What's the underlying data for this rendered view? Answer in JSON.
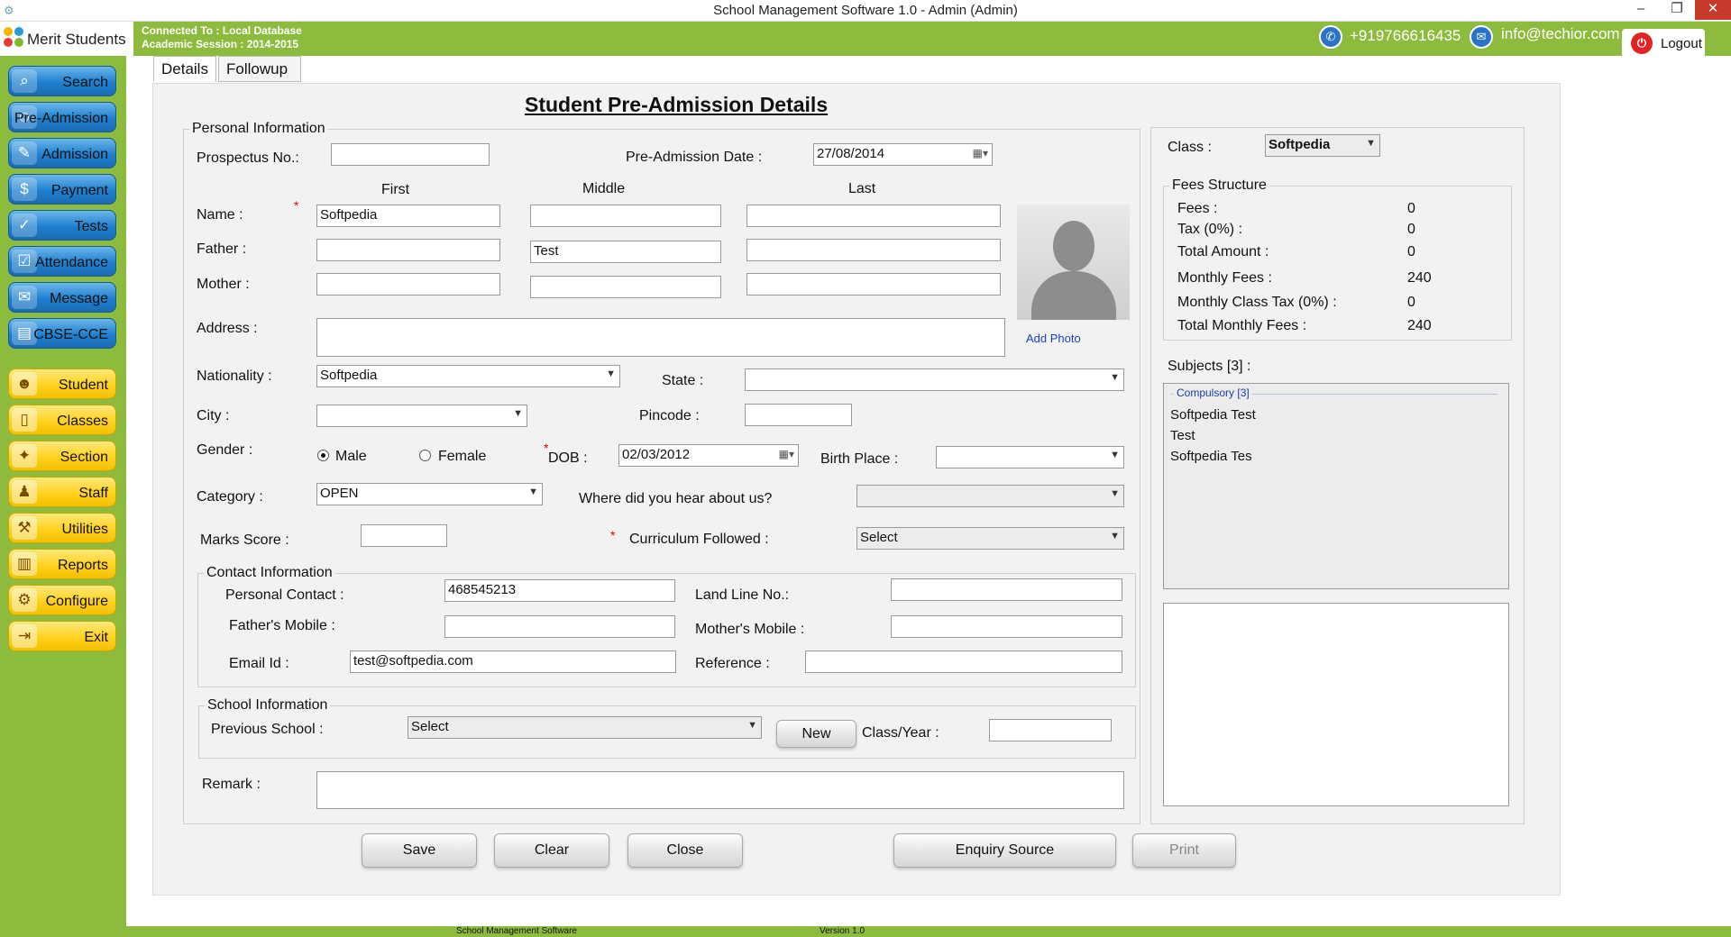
{
  "window": {
    "title": "School Management Software 1.0  -  Admin (Admin)",
    "min": "–",
    "max": "❐",
    "close": "✕"
  },
  "brand": {
    "name": "Merit Students"
  },
  "connection": {
    "line1": "Connected To : Local Database",
    "line2": "Academic Session : 2014-2015"
  },
  "contact": {
    "phone": "+919766616435",
    "email": "info@techior.com"
  },
  "logout": {
    "label": "Logout"
  },
  "sidebar": {
    "blue": [
      "Search",
      "Pre-Admission",
      "Admission",
      "Payment",
      "Tests",
      "Attendance",
      "Message",
      "CBSE-CCE"
    ],
    "yellow": [
      "Student",
      "Classes",
      "Section",
      "Staff",
      "Utilities",
      "Reports",
      "Configure",
      "Exit"
    ]
  },
  "tabs": [
    "Details",
    "Followup"
  ],
  "page": {
    "title": "Student Pre-Admission Details"
  },
  "personal": {
    "legend": "Personal Information",
    "prospectus_label": "Prospectus No.:",
    "prospectus_value": "",
    "preadmission_date_label": "Pre-Admission Date :",
    "preadmission_date": "27/08/2014",
    "col_first": "First",
    "col_middle": "Middle",
    "col_last": "Last",
    "name_label": "Name :",
    "name_first": "Softpedia",
    "name_middle": "",
    "name_last": "",
    "father_label": "Father :",
    "father_first": "",
    "father_middle": "Test",
    "father_last": "",
    "mother_label": "Mother :",
    "mother_first": "",
    "mother_middle": "",
    "mother_last": "",
    "address_label": "Address :",
    "address_value": "",
    "add_photo": "Add Photo",
    "nationality_label": "Nationality :",
    "nationality_value": "Softpedia",
    "state_label": "State :",
    "state_value": "",
    "city_label": "City :",
    "city_value": "",
    "pincode_label": "Pincode :",
    "pincode_value": "",
    "gender_label": "Gender :",
    "gender_male": "Male",
    "gender_female": "Female",
    "gender_selected": "Male",
    "dob_label": "DOB :",
    "dob_value": "02/03/2012",
    "birthplace_label": "Birth Place :",
    "birthplace_value": "",
    "category_label": "Category :",
    "category_value": "OPEN",
    "hear_label": "Where did you hear about us?",
    "hear_value": "",
    "marks_label": "Marks Score :",
    "marks_value": "",
    "curriculum_label": "Curriculum Followed :",
    "curriculum_value": "Select"
  },
  "contact_info": {
    "legend": "Contact Information",
    "personal_contact_label": "Personal Contact :",
    "personal_contact": "468545213",
    "landline_label": "Land Line No.:",
    "landline": "",
    "father_mobile_label": "Father's Mobile :",
    "father_mobile": "",
    "mother_mobile_label": "Mother's Mobile :",
    "mother_mobile": "",
    "email_label": "Email Id :",
    "email": "test@softpedia.com",
    "reference_label": "Reference :",
    "reference": ""
  },
  "school_info": {
    "legend": "School Information",
    "previous_school_label": "Previous School :",
    "previous_school": "Select",
    "new_button": "New",
    "class_year_label": "Class/Year :",
    "class_year": ""
  },
  "remark": {
    "label": "Remark :",
    "value": ""
  },
  "class_panel": {
    "class_label": "Class :",
    "class_value": "Softpedia",
    "fees_legend": "Fees Structure",
    "fees": [
      {
        "label": "Fees :",
        "value": "0"
      },
      {
        "label": "Tax (0%) :",
        "value": "0"
      },
      {
        "label": "Total Amount :",
        "value": "0"
      },
      {
        "label": "Monthly Fees :",
        "value": "240"
      },
      {
        "label": "Monthly Class Tax (0%) :",
        "value": "0"
      },
      {
        "label": "Total Monthly Fees :",
        "value": "240"
      }
    ],
    "subjects_label": "Subjects [3] :",
    "compulsory_legend": "Compulsory [3]",
    "subjects": [
      "Softpedia Test",
      "Test",
      "Softpedia Tes"
    ]
  },
  "buttons": {
    "save": "Save",
    "clear": "Clear",
    "close": "Close",
    "enquiry": "Enquiry Source",
    "print": "Print"
  },
  "status": {
    "left": "School Management Software",
    "right": "Version 1.0"
  }
}
